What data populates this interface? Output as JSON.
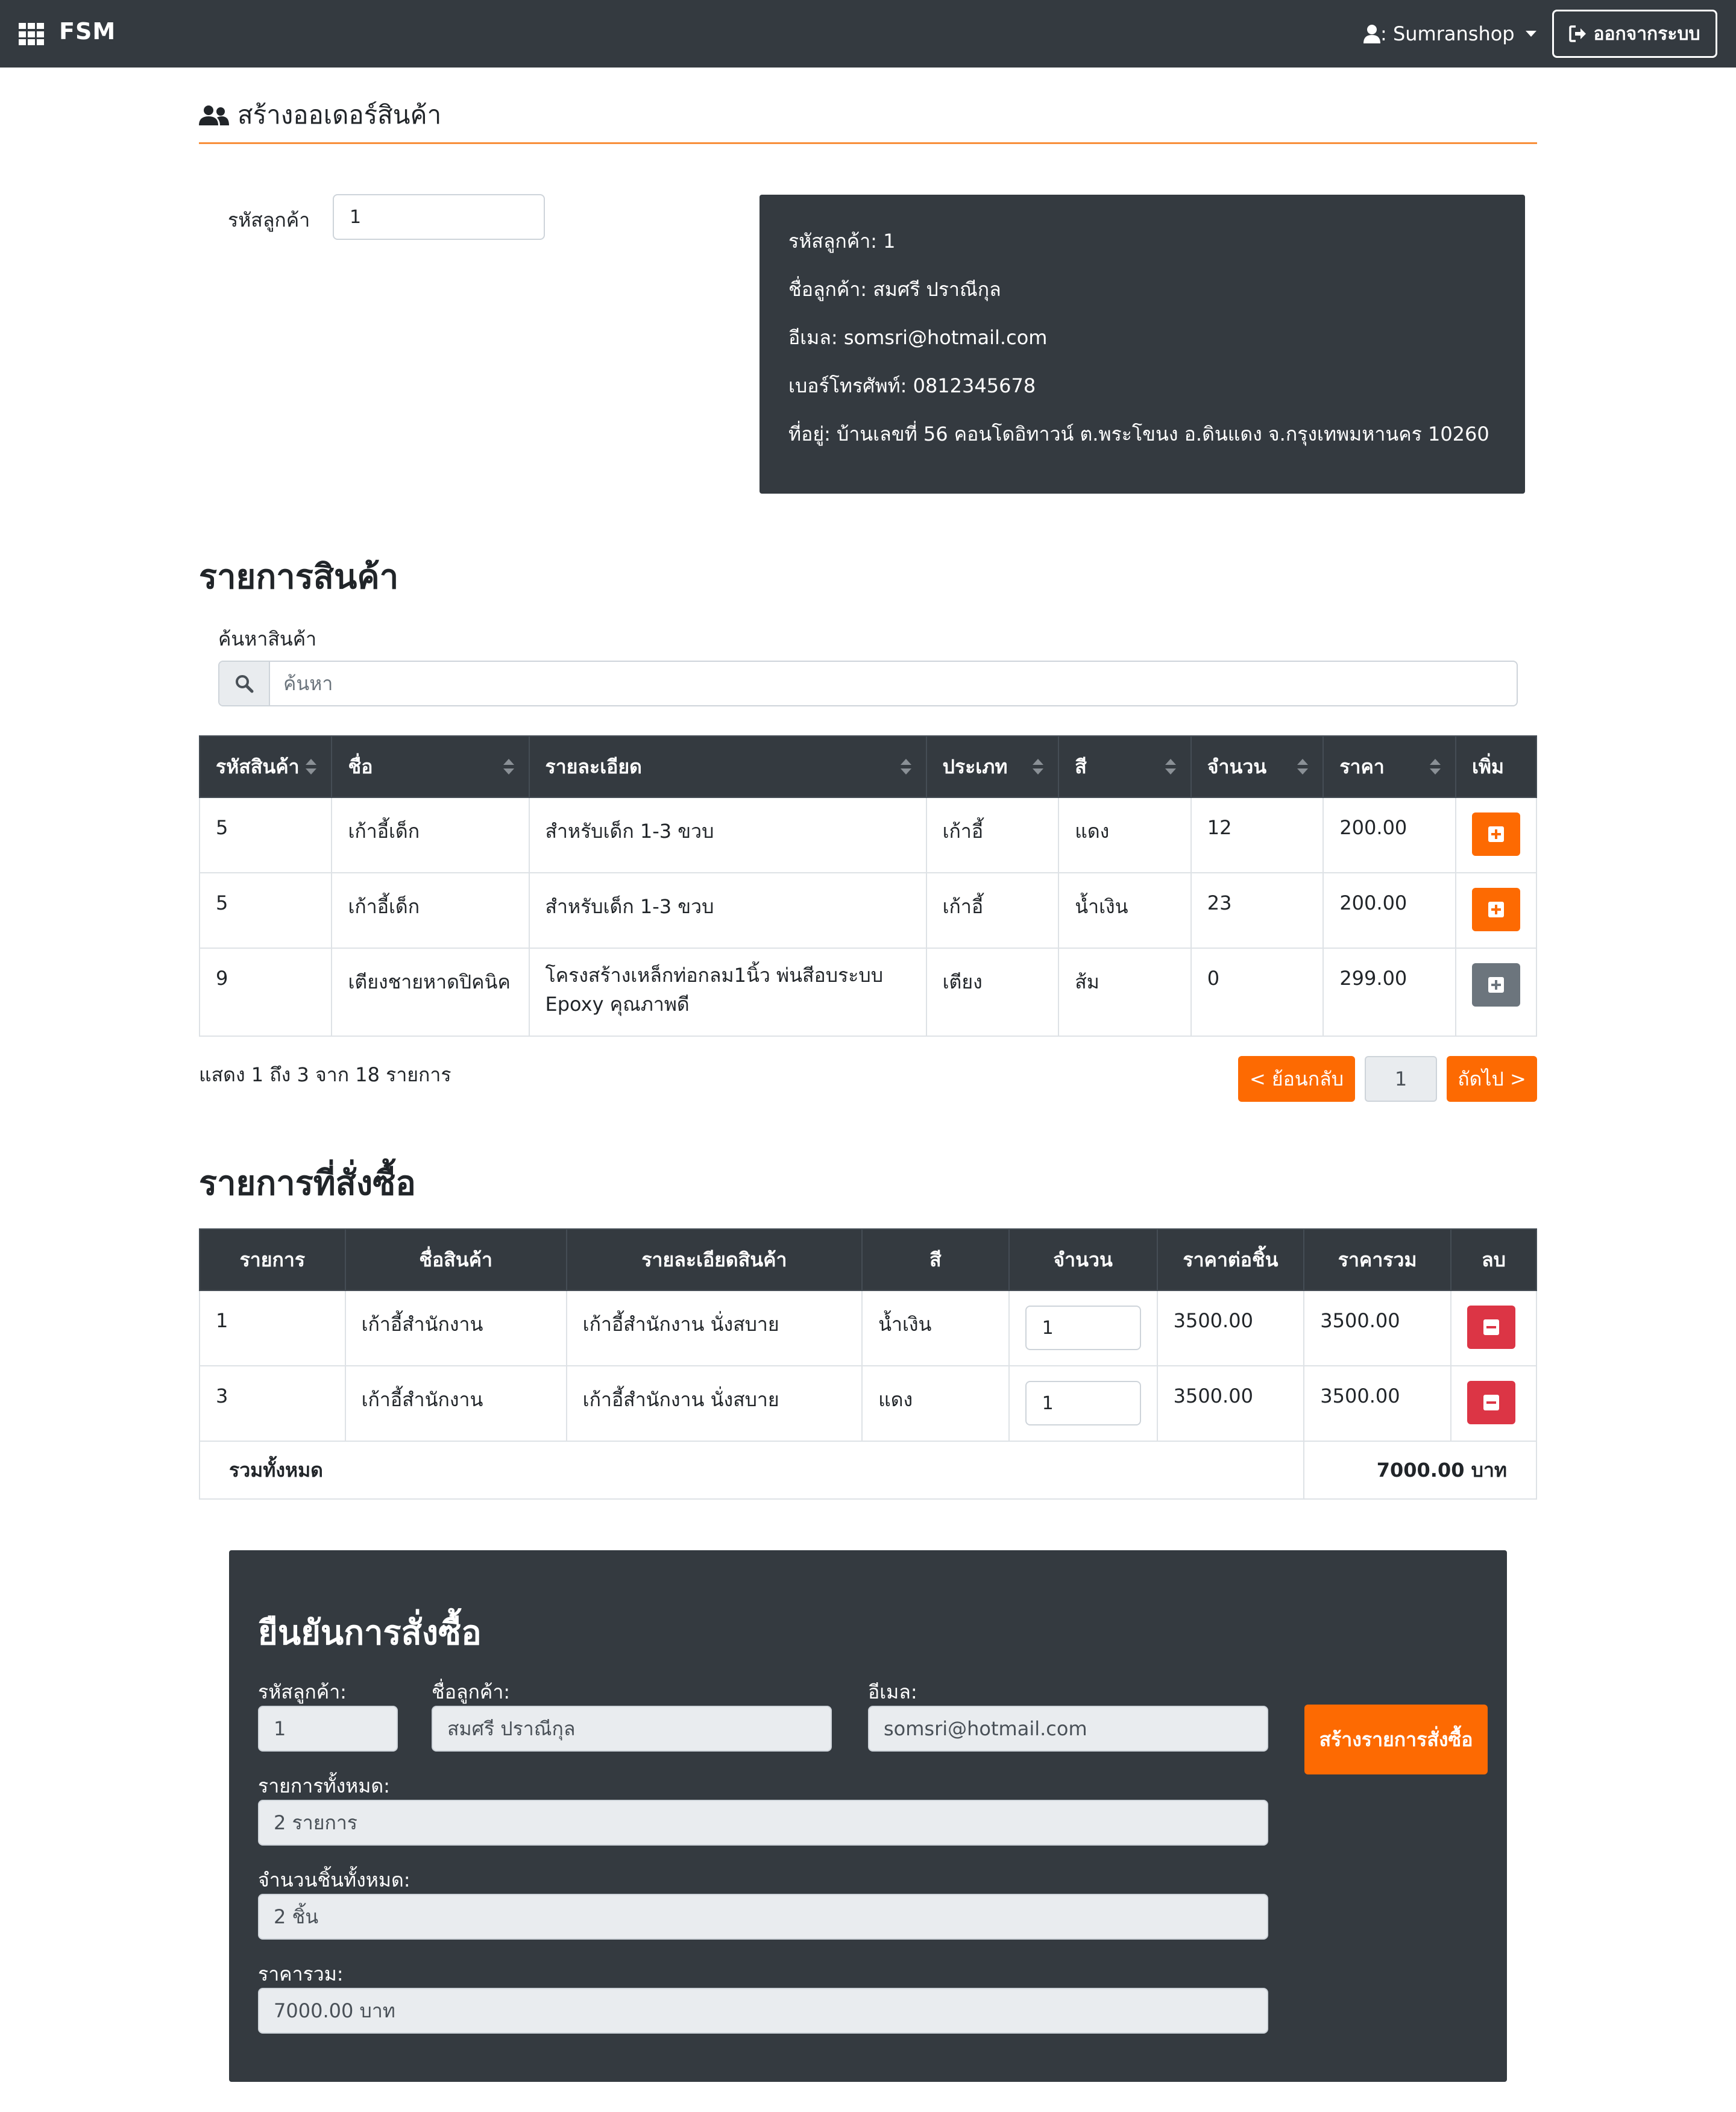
{
  "navbar": {
    "brand": "FSM",
    "user_label": ": Sumranshop",
    "logout_label": "ออกจากระบบ"
  },
  "page": {
    "title": "สร้างออเดอร์สินค้า"
  },
  "customer_lookup": {
    "label": "รหัสลูกค้า",
    "value": "1"
  },
  "customer_card": {
    "code": "รหัสลูกค้า: 1",
    "name": "ชื่อลูกค้า: สมศรี ปราณีกุล",
    "email": "อีเมล: somsri@hotmail.com",
    "phone": "เบอร์โทรศัพท์: 0812345678",
    "address": "ที่อยู่: บ้านเลขที่ 56 คอนโดอิทาวน์ ต.พระโขนง อ.ดินแดง จ.กรุงเทพมหานคร 10260"
  },
  "products": {
    "heading": "รายการสินค้า",
    "search_label": "ค้นหาสินค้า",
    "search_placeholder": "ค้นหา",
    "columns": [
      "รหัสสินค้า",
      "ชื่อ",
      "รายละเอียด",
      "ประเภท",
      "สี",
      "จำนวน",
      "ราคา",
      "เพิ่ม"
    ],
    "rows": [
      {
        "code": "5",
        "name": "เก้าอี้เด็ก",
        "detail": "สำหรับเด็ก 1-3 ขวบ",
        "type": "เก้าอี้",
        "color": "แดง",
        "qty": "12",
        "price": "200.00",
        "available": true
      },
      {
        "code": "5",
        "name": "เก้าอี้เด็ก",
        "detail": "สำหรับเด็ก 1-3 ขวบ",
        "type": "เก้าอี้",
        "color": "น้ำเงิน",
        "qty": "23",
        "price": "200.00",
        "available": true
      },
      {
        "code": "9",
        "name": "เตียงชายหาดปิคนิค",
        "detail": "โครงสร้างเหล็กท่อกลม1นิ้ว พ่นสีอบระบบ Epoxy คุณภาพดี",
        "type": "เตียง",
        "color": "ส้ม",
        "qty": "0",
        "price": "299.00",
        "available": false
      }
    ],
    "info_text": "แสดง 1 ถึง 3 จาก 18 รายการ",
    "prev_label": "< ย้อนกลับ",
    "page_number": "1",
    "next_label": "ถัดไป >"
  },
  "order": {
    "heading": "รายการที่สั่งซื้อ",
    "columns": [
      "รายการ",
      "ชื่อสินค้า",
      "รายละเอียดสินค้า",
      "สี",
      "จำนวน",
      "ราคาต่อชิ้น",
      "ราคารวม",
      "ลบ"
    ],
    "rows": [
      {
        "no": "1",
        "name": "เก้าอี้สำนักงาน",
        "detail": "เก้าอี้สำนักงาน นั่งสบาย",
        "color": "น้ำเงิน",
        "qty": "1",
        "unit_price": "3500.00",
        "total": "3500.00"
      },
      {
        "no": "3",
        "name": "เก้าอี้สำนักงาน",
        "detail": "เก้าอี้สำนักงาน นั่งสบาย",
        "color": "แดง",
        "qty": "1",
        "unit_price": "3500.00",
        "total": "3500.00"
      }
    ],
    "total_label": "รวมทั้งหมด",
    "total_value": "7000.00 บาท"
  },
  "confirm": {
    "title": "ยืนยันการสั่งซื้อ",
    "code_label": "รหัสลูกค้า:",
    "code_value": "1",
    "name_label": "ชื่อลูกค้า:",
    "name_value": "สมศรี ปราณีกุล",
    "email_label": "อีเมล:",
    "email_value": "somsri@hotmail.com",
    "items_label": "รายการทั้งหมด:",
    "items_value": "2 รายการ",
    "pieces_label": "จำนวนชิ้นทั้งหมด:",
    "pieces_value": "2 ชิ้น",
    "price_label": "ราคารวม:",
    "price_value": "7000.00 บาท",
    "submit_label": "สร้างรายการสั่งซื้อ"
  },
  "colors": {
    "navbar_bg": "#343a40",
    "accent_orange": "#fd6a02",
    "danger_red": "#dc3545",
    "disabled_gray": "#6c757d",
    "rule_orange": "#f88f3a"
  }
}
